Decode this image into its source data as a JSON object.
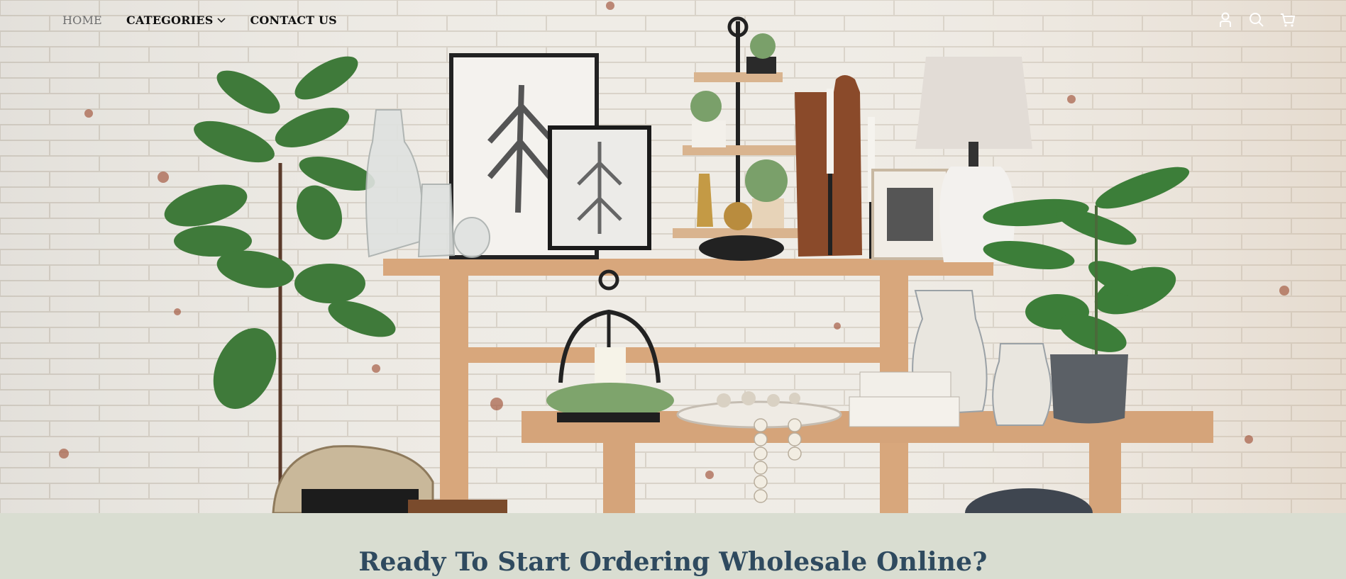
{
  "nav": {
    "links": [
      {
        "label": "HOME",
        "active": true
      },
      {
        "label": "CATEGORIES",
        "has_dropdown": true
      },
      {
        "label": "CONTACT US"
      }
    ],
    "icons": [
      "account-icon",
      "search-icon",
      "cart-icon"
    ]
  },
  "hero": {
    "background_color": "#e8e2d8",
    "brick_color": "#efece6",
    "mortar_color": "#d9d3c9",
    "wood_color": "#d8a77c"
  },
  "band": {
    "title": "Ready To Start Ordering Wholesale Online?",
    "title_color": "#2f4a5f",
    "background_color": "#d9ddd1"
  }
}
